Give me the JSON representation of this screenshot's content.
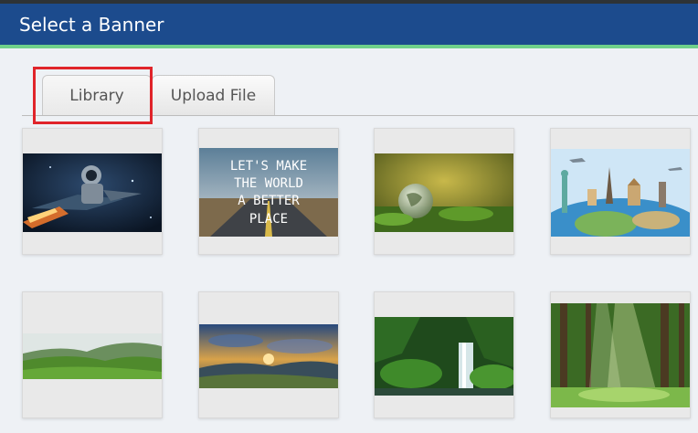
{
  "dialog": {
    "title": "Select a Banner"
  },
  "tabs": [
    {
      "label": "Library",
      "active": true
    },
    {
      "label": "Upload File",
      "active": false
    }
  ],
  "banners": [
    {
      "name": "astronaut-rocket",
      "caption_lines": []
    },
    {
      "name": "road-quote",
      "caption_lines": [
        "LET'S MAKE",
        "THE WORLD",
        "A BETTER",
        "PLACE"
      ]
    },
    {
      "name": "glass-globe",
      "caption_lines": []
    },
    {
      "name": "world-landmarks",
      "caption_lines": []
    },
    {
      "name": "green-hills",
      "caption_lines": []
    },
    {
      "name": "sunset-valley",
      "caption_lines": []
    },
    {
      "name": "jungle-waterfall",
      "caption_lines": []
    },
    {
      "name": "sunlit-forest",
      "caption_lines": []
    }
  ],
  "colors": {
    "header_bg": "#1c4b8d",
    "header_accent": "#6fd08a",
    "highlight_border": "#e0242a",
    "page_bg": "#eef1f5"
  }
}
